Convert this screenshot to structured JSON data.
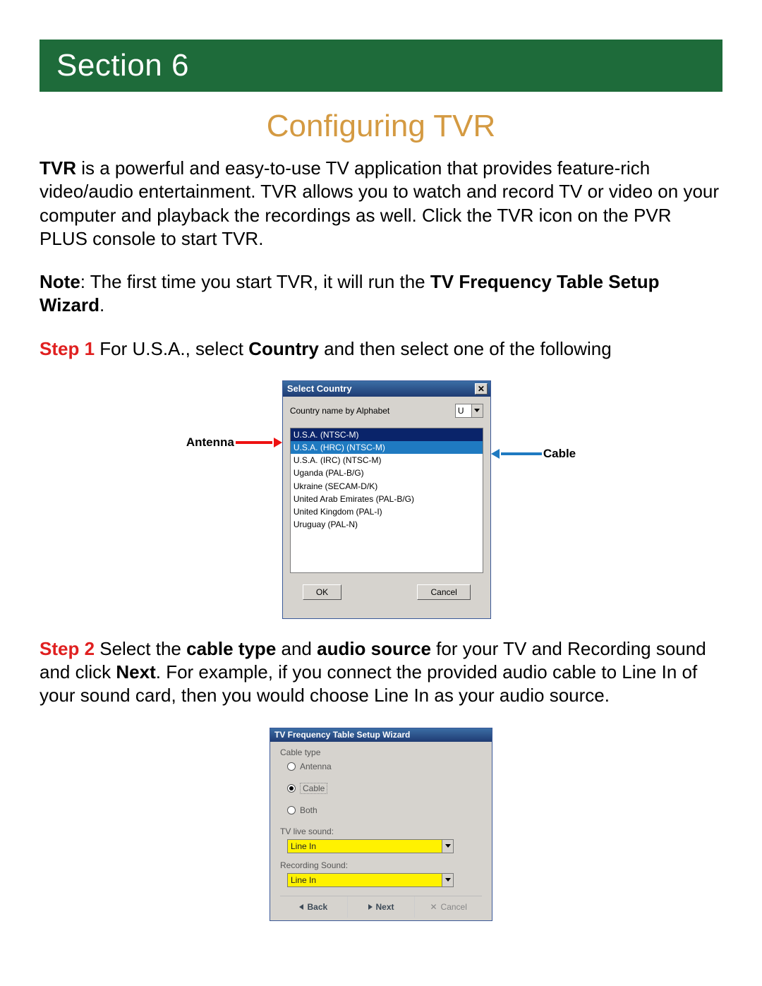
{
  "section_banner": "Section 6",
  "title": "Configuring TVR",
  "intro": {
    "tvr": "TVR",
    "text": " is a powerful and easy-to-use TV application that provides feature-rich video/audio entertainment. TVR allows you to watch and record TV or video on your computer and playback the recordings as well. Click the TVR icon on the PVR PLUS console to start TVR."
  },
  "note": {
    "label": "Note",
    "text": ": The first time you start TVR, it will run the ",
    "bold": "TV Frequency Table Setup Wizard",
    "end": "."
  },
  "step1": {
    "label": "Step 1",
    "part1": " For U.S.A., select ",
    "bold1": "Country",
    "part2": " and then select one of the following"
  },
  "annot_antenna": "Antenna",
  "annot_cable": "Cable",
  "dialog1": {
    "title": "Select Country",
    "close": "✕",
    "name_label": "Country name by Alphabet",
    "letter": "U",
    "items": [
      "U.S.A. (NTSC-M)",
      "U.S.A. (HRC) (NTSC-M)",
      "U.S.A. (IRC) (NTSC-M)",
      "Uganda (PAL-B/G)",
      "Ukraine (SECAM-D/K)",
      "United Arab Emirates (PAL-B/G)",
      "United Kingdom (PAL-I)",
      "Uruguay (PAL-N)"
    ],
    "ok": "OK",
    "cancel": "Cancel"
  },
  "step2": {
    "label": "Step 2",
    "p1": " Select the ",
    "b1": "cable type",
    "p2": " and ",
    "b2": "audio source",
    "p3": " for your TV and Recording sound and click ",
    "b3": "Next",
    "p4": ". For example, if you connect the provided audio cable to Line In of your sound card, then you would choose Line In as your audio source."
  },
  "dialog2": {
    "title": "TV Frequency Table Setup Wizard",
    "cable_type": "Cable type",
    "r_antenna": "Antenna",
    "r_cable": "Cable",
    "r_both": "Both",
    "tv_live": "TV live sound:",
    "rec_sound": "Recording Sound:",
    "linein": "Line In",
    "back": "Back",
    "next": "Next",
    "cancel": "Cancel"
  }
}
